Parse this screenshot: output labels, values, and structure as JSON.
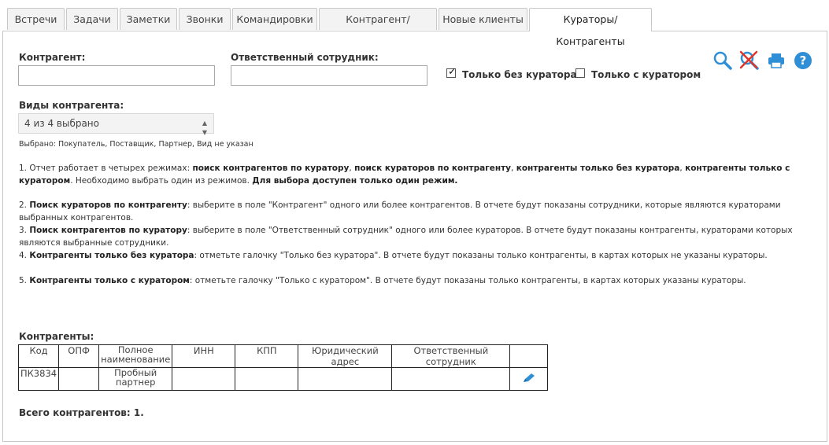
{
  "tabs": [
    {
      "label": "Встречи",
      "active": false
    },
    {
      "label": "Задачи",
      "active": false
    },
    {
      "label": "Заметки",
      "active": false
    },
    {
      "label": "Звонки",
      "active": false
    },
    {
      "label": "Командировки",
      "active": false
    },
    {
      "label": "Контрагент/сотрудник",
      "active": false
    },
    {
      "label": "Новые клиенты",
      "active": false
    },
    {
      "label": "Кураторы/Контрагенты",
      "active": true
    }
  ],
  "filters": {
    "counterparty_label": "Контрагент:",
    "counterparty_value": "",
    "employee_label": "Ответственный сотрудник:",
    "employee_value": "",
    "only_without_curator_label": "Только без куратора",
    "only_without_curator_checked": true,
    "only_with_curator_label": "Только с куратором",
    "only_with_curator_checked": false,
    "types_label": "Виды контрагента:",
    "types_selected": "4 из 4 выбрано",
    "selected_note": "Выбрано: Покупатель, Поставщик, Партнер, Вид не указан"
  },
  "toolbar": {
    "search_icon": "search-icon",
    "clear_search_icon": "clear-search-icon",
    "print_icon": "print-icon",
    "help_icon": "help-icon",
    "accent": "#2f8fd6"
  },
  "help": {
    "p1": {
      "num": "1. Отчет работает в четырех режимах: ",
      "b1": "поиск контрагентов по куратору",
      "s1": ", ",
      "b2": "поиск кураторов по контрагенту",
      "s2": ", ",
      "b3": "контрагенты только без куратора",
      "s3": ", ",
      "b4": "контрагенты только с куратором",
      "s4": ". Необходимо выбрать один из режимов. ",
      "b5": "Для выбора доступен только один режим."
    },
    "p2": {
      "num": "2. ",
      "b": "Поиск кураторов по контрагенту",
      "t": ": выберите в поле \"Контрагент\" одного или более контрагентов. В отчете будут показаны сотрудники, которые являются кураторами выбранных контрагентов."
    },
    "p3": {
      "num": "3. ",
      "b": "Поиск контрагентов по куратору",
      "t": ": выберите в поле \"Ответственный сотрудник\" одного или более кураторов. В отчете будут показаны контрагенты, кураторами которых являются выбранные сотрудники."
    },
    "p4": {
      "num": "4. ",
      "b": "Контрагенты только без куратора",
      "t": ": отметьте галочку \"Только без куратора\". В отчете будут показаны только контрагенты, в картах которых не указаны кураторы."
    },
    "p5": {
      "num": "5. ",
      "b": "Контрагенты только с куратором",
      "t": ": отметьте галочку \"Только с куратором\". В отчете будут показаны только контрагенты, в картах которых указаны кураторы."
    }
  },
  "results": {
    "title": "Контрагенты:",
    "columns": [
      "Код",
      "ОПФ",
      "Полное наименование",
      "ИНН",
      "КПП",
      "Юридический адрес",
      "Ответственный сотрудник",
      ""
    ],
    "rows": [
      {
        "code": "ПК3834",
        "opf": "",
        "name": "Пробный партнер",
        "inn": "",
        "kpp": "",
        "address": "",
        "employee": "",
        "edit_icon": "edit-pencil-icon"
      }
    ],
    "total": "Всего контрагентов: 1."
  }
}
